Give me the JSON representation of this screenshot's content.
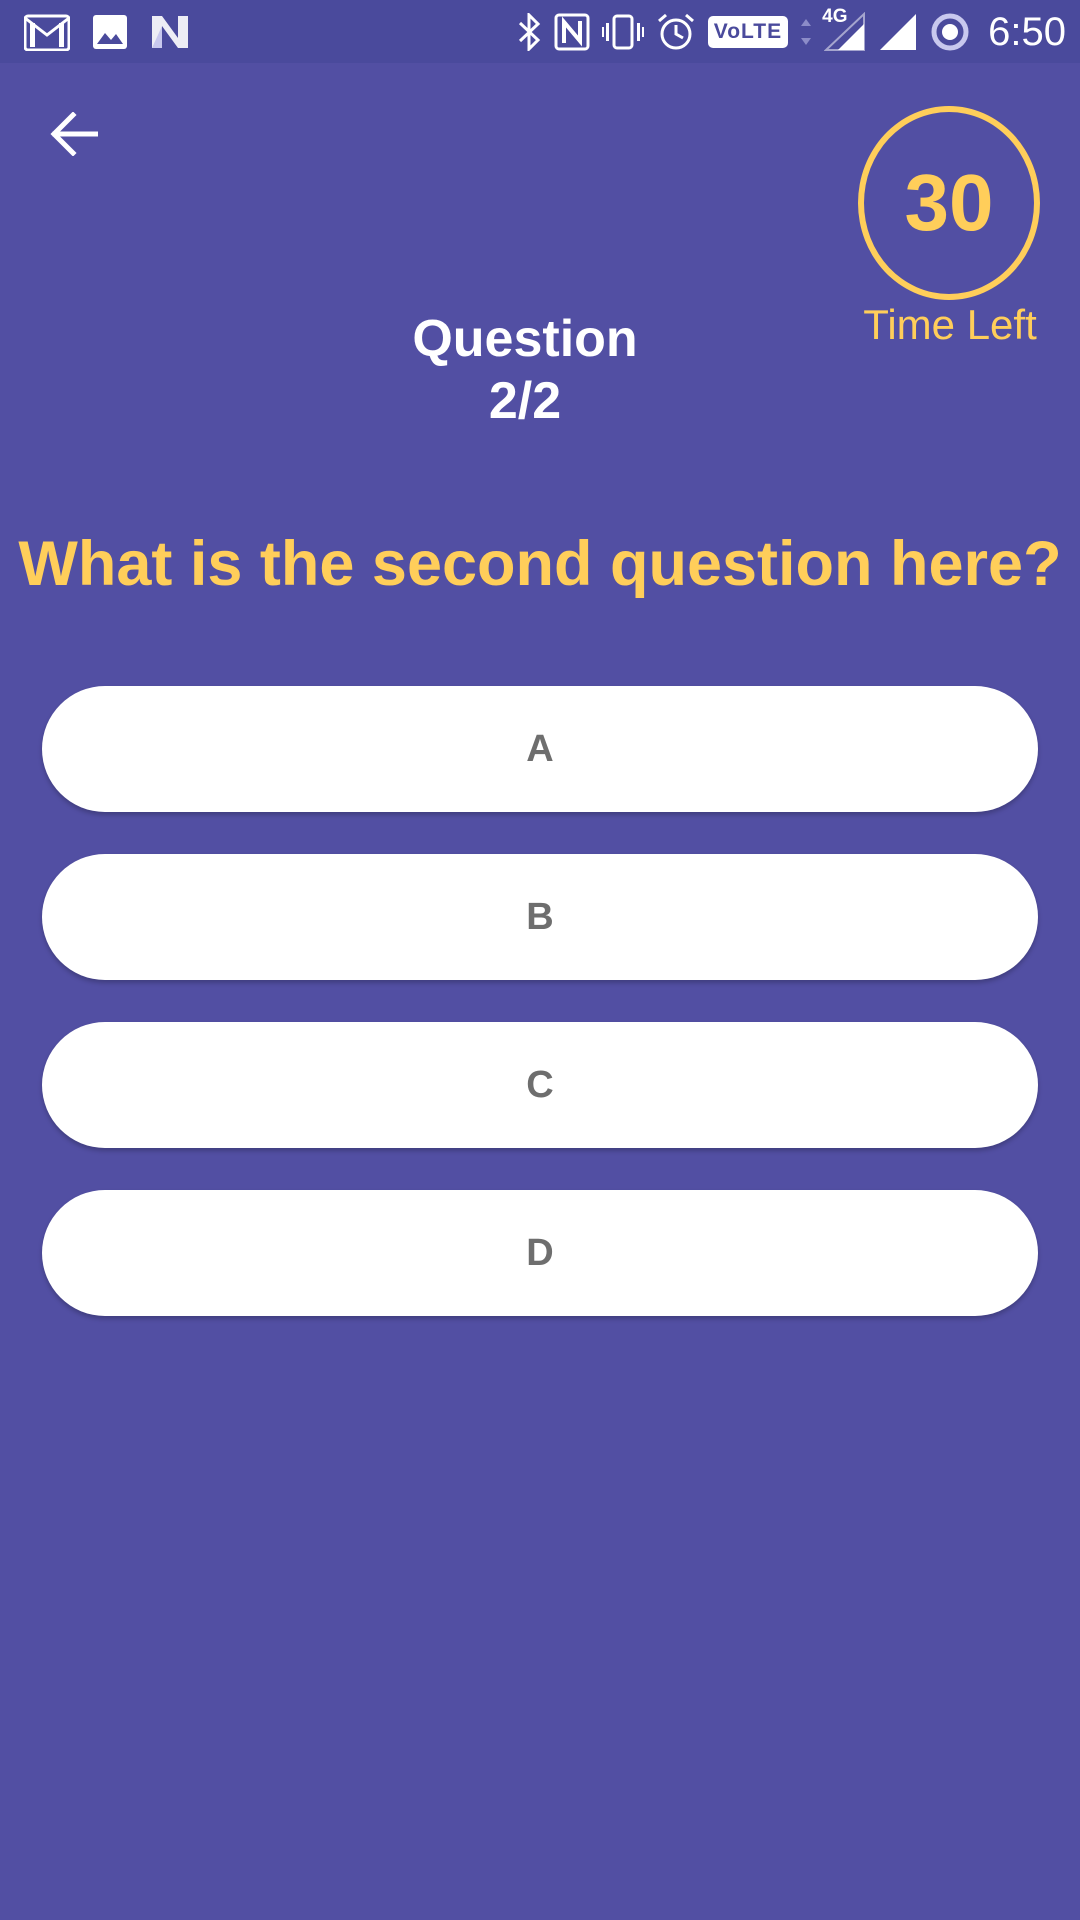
{
  "status_bar": {
    "left_icons": [
      "gmail-icon",
      "gallery-icon",
      "n-logo-icon"
    ],
    "right_icons": [
      "bluetooth-icon",
      "nfc-icon",
      "vibrate-icon",
      "alarm-icon",
      "volte-icon",
      "data-arrows-icon",
      "signal-4g-icon",
      "signal-icon",
      "sync-icon"
    ],
    "volte": "VoLTE",
    "network": "4G",
    "time": "6:50"
  },
  "header": {
    "back_icon": "arrow-back-icon",
    "question_label": "Question",
    "question_progress": "2/2"
  },
  "timer": {
    "value": "30",
    "label": "Time Left"
  },
  "question": {
    "text": "What is the second question here?"
  },
  "options": [
    {
      "label": "A"
    },
    {
      "label": "B"
    },
    {
      "label": "C"
    },
    {
      "label": "D"
    }
  ],
  "colors": {
    "background": "#524fa3",
    "status_bar": "#4a4a9c",
    "accent": "#ffce5a",
    "option_background": "#ffffff",
    "option_text": "#6e6e6e"
  }
}
